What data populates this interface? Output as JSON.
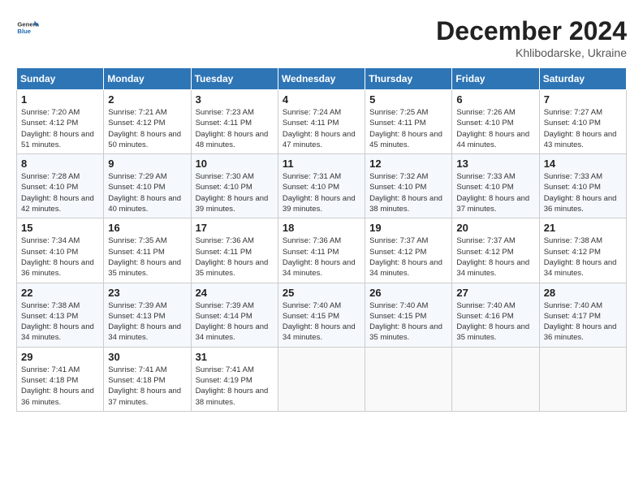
{
  "logo": {
    "text_general": "General",
    "text_blue": "Blue"
  },
  "header": {
    "month_year": "December 2024",
    "location": "Khlibodarske, Ukraine"
  },
  "weekdays": [
    "Sunday",
    "Monday",
    "Tuesday",
    "Wednesday",
    "Thursday",
    "Friday",
    "Saturday"
  ],
  "weeks": [
    [
      {
        "day": 1,
        "sunrise": "7:20 AM",
        "sunset": "4:12 PM",
        "daylight": "8 hours and 51 minutes."
      },
      {
        "day": 2,
        "sunrise": "7:21 AM",
        "sunset": "4:12 PM",
        "daylight": "8 hours and 50 minutes."
      },
      {
        "day": 3,
        "sunrise": "7:23 AM",
        "sunset": "4:11 PM",
        "daylight": "8 hours and 48 minutes."
      },
      {
        "day": 4,
        "sunrise": "7:24 AM",
        "sunset": "4:11 PM",
        "daylight": "8 hours and 47 minutes."
      },
      {
        "day": 5,
        "sunrise": "7:25 AM",
        "sunset": "4:11 PM",
        "daylight": "8 hours and 45 minutes."
      },
      {
        "day": 6,
        "sunrise": "7:26 AM",
        "sunset": "4:10 PM",
        "daylight": "8 hours and 44 minutes."
      },
      {
        "day": 7,
        "sunrise": "7:27 AM",
        "sunset": "4:10 PM",
        "daylight": "8 hours and 43 minutes."
      }
    ],
    [
      {
        "day": 8,
        "sunrise": "7:28 AM",
        "sunset": "4:10 PM",
        "daylight": "8 hours and 42 minutes."
      },
      {
        "day": 9,
        "sunrise": "7:29 AM",
        "sunset": "4:10 PM",
        "daylight": "8 hours and 40 minutes."
      },
      {
        "day": 10,
        "sunrise": "7:30 AM",
        "sunset": "4:10 PM",
        "daylight": "8 hours and 39 minutes."
      },
      {
        "day": 11,
        "sunrise": "7:31 AM",
        "sunset": "4:10 PM",
        "daylight": "8 hours and 39 minutes."
      },
      {
        "day": 12,
        "sunrise": "7:32 AM",
        "sunset": "4:10 PM",
        "daylight": "8 hours and 38 minutes."
      },
      {
        "day": 13,
        "sunrise": "7:33 AM",
        "sunset": "4:10 PM",
        "daylight": "8 hours and 37 minutes."
      },
      {
        "day": 14,
        "sunrise": "7:33 AM",
        "sunset": "4:10 PM",
        "daylight": "8 hours and 36 minutes."
      }
    ],
    [
      {
        "day": 15,
        "sunrise": "7:34 AM",
        "sunset": "4:10 PM",
        "daylight": "8 hours and 36 minutes."
      },
      {
        "day": 16,
        "sunrise": "7:35 AM",
        "sunset": "4:11 PM",
        "daylight": "8 hours and 35 minutes."
      },
      {
        "day": 17,
        "sunrise": "7:36 AM",
        "sunset": "4:11 PM",
        "daylight": "8 hours and 35 minutes."
      },
      {
        "day": 18,
        "sunrise": "7:36 AM",
        "sunset": "4:11 PM",
        "daylight": "8 hours and 34 minutes."
      },
      {
        "day": 19,
        "sunrise": "7:37 AM",
        "sunset": "4:12 PM",
        "daylight": "8 hours and 34 minutes."
      },
      {
        "day": 20,
        "sunrise": "7:37 AM",
        "sunset": "4:12 PM",
        "daylight": "8 hours and 34 minutes."
      },
      {
        "day": 21,
        "sunrise": "7:38 AM",
        "sunset": "4:12 PM",
        "daylight": "8 hours and 34 minutes."
      }
    ],
    [
      {
        "day": 22,
        "sunrise": "7:38 AM",
        "sunset": "4:13 PM",
        "daylight": "8 hours and 34 minutes."
      },
      {
        "day": 23,
        "sunrise": "7:39 AM",
        "sunset": "4:13 PM",
        "daylight": "8 hours and 34 minutes."
      },
      {
        "day": 24,
        "sunrise": "7:39 AM",
        "sunset": "4:14 PM",
        "daylight": "8 hours and 34 minutes."
      },
      {
        "day": 25,
        "sunrise": "7:40 AM",
        "sunset": "4:15 PM",
        "daylight": "8 hours and 34 minutes."
      },
      {
        "day": 26,
        "sunrise": "7:40 AM",
        "sunset": "4:15 PM",
        "daylight": "8 hours and 35 minutes."
      },
      {
        "day": 27,
        "sunrise": "7:40 AM",
        "sunset": "4:16 PM",
        "daylight": "8 hours and 35 minutes."
      },
      {
        "day": 28,
        "sunrise": "7:40 AM",
        "sunset": "4:17 PM",
        "daylight": "8 hours and 36 minutes."
      }
    ],
    [
      {
        "day": 29,
        "sunrise": "7:41 AM",
        "sunset": "4:18 PM",
        "daylight": "8 hours and 36 minutes."
      },
      {
        "day": 30,
        "sunrise": "7:41 AM",
        "sunset": "4:18 PM",
        "daylight": "8 hours and 37 minutes."
      },
      {
        "day": 31,
        "sunrise": "7:41 AM",
        "sunset": "4:19 PM",
        "daylight": "8 hours and 38 minutes."
      },
      null,
      null,
      null,
      null
    ]
  ]
}
